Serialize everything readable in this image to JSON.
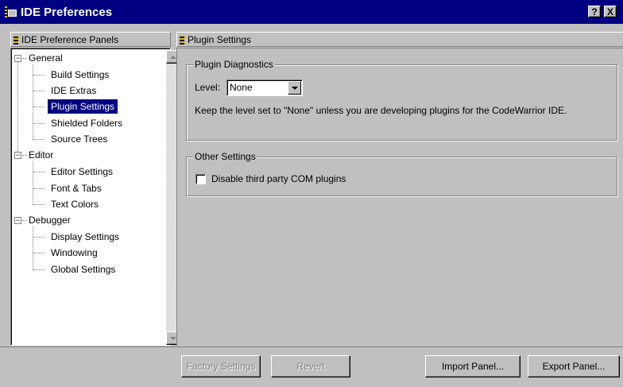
{
  "window": {
    "title": "IDE Preferences",
    "help_button": "?",
    "close_button": "X"
  },
  "tree": {
    "header": "IDE Preference Panels",
    "groups": [
      {
        "label": "General",
        "expanded": true,
        "items": [
          "Build Settings",
          "IDE Extras",
          "Plugin Settings",
          "Shielded Folders",
          "Source Trees"
        ]
      },
      {
        "label": "Editor",
        "expanded": true,
        "items": [
          "Editor Settings",
          "Font & Tabs",
          "Text Colors"
        ]
      },
      {
        "label": "Debugger",
        "expanded": true,
        "items": [
          "Display Settings",
          "Windowing",
          "Global Settings"
        ]
      }
    ],
    "selected": "Plugin Settings"
  },
  "panel": {
    "header": "Plugin Settings",
    "diagnostics": {
      "title": "Plugin Diagnostics",
      "level_label": "Level:",
      "level_value": "None",
      "hint": "Keep the level set to \"None\" unless you are developing plugins for the CodeWarrior IDE."
    },
    "other": {
      "title": "Other Settings",
      "checkbox_label": "Disable third party COM plugins",
      "checked": false
    }
  },
  "buttons": {
    "factory": "Factory Settings",
    "revert": "Revert",
    "import": "Import Panel...",
    "export": "Export Panel..."
  }
}
